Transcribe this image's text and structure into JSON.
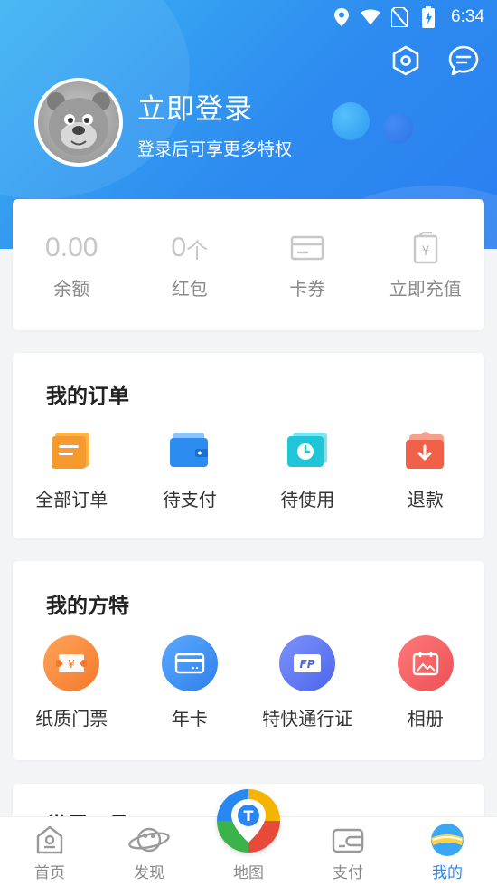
{
  "status_bar": {
    "time": "6:34"
  },
  "profile": {
    "login_title": "立即登录",
    "login_subtitle": "登录后可享更多特权"
  },
  "wallet": {
    "balance_value": "0.00",
    "balance_label": "余额",
    "redpacket_value": "0",
    "redpacket_unit": "个",
    "redpacket_label": "红包",
    "coupon_label": "卡券",
    "recharge_label": "立即充值"
  },
  "orders": {
    "title": "我的订单",
    "items": [
      {
        "label": "全部订单",
        "icon": "order-list-icon",
        "color": "#f79a2e"
      },
      {
        "label": "待支付",
        "icon": "wallet-icon",
        "color": "#2d8cf0"
      },
      {
        "label": "待使用",
        "icon": "clock-ticket-icon",
        "color": "#1ec6d8"
      },
      {
        "label": "退款",
        "icon": "refund-icon",
        "color": "#f0614a"
      }
    ]
  },
  "fangte": {
    "title": "我的方特",
    "items": [
      {
        "label": "纸质门票",
        "icon": "paper-ticket-icon",
        "color": "#f7893a"
      },
      {
        "label": "年卡",
        "icon": "annual-card-icon",
        "color": "#3a8ff0"
      },
      {
        "label": "特快通行证",
        "icon": "fastpass-icon",
        "color": "#5b78f0"
      },
      {
        "label": "相册",
        "icon": "album-icon",
        "color": "#f25f5f"
      }
    ]
  },
  "tools": {
    "title": "常用工具"
  },
  "tabbar": {
    "items": [
      {
        "label": "首页",
        "icon": "home-icon",
        "active": false
      },
      {
        "label": "发现",
        "icon": "planet-icon",
        "active": false
      },
      {
        "label": "地图",
        "icon": "map-icon",
        "active": false
      },
      {
        "label": "支付",
        "icon": "pay-icon",
        "active": false
      },
      {
        "label": "我的",
        "icon": "mine-icon",
        "active": true
      }
    ]
  },
  "colors": {
    "accent": "#2a86f0",
    "header_start": "#3bb3f2",
    "header_end": "#2a7ef0"
  }
}
